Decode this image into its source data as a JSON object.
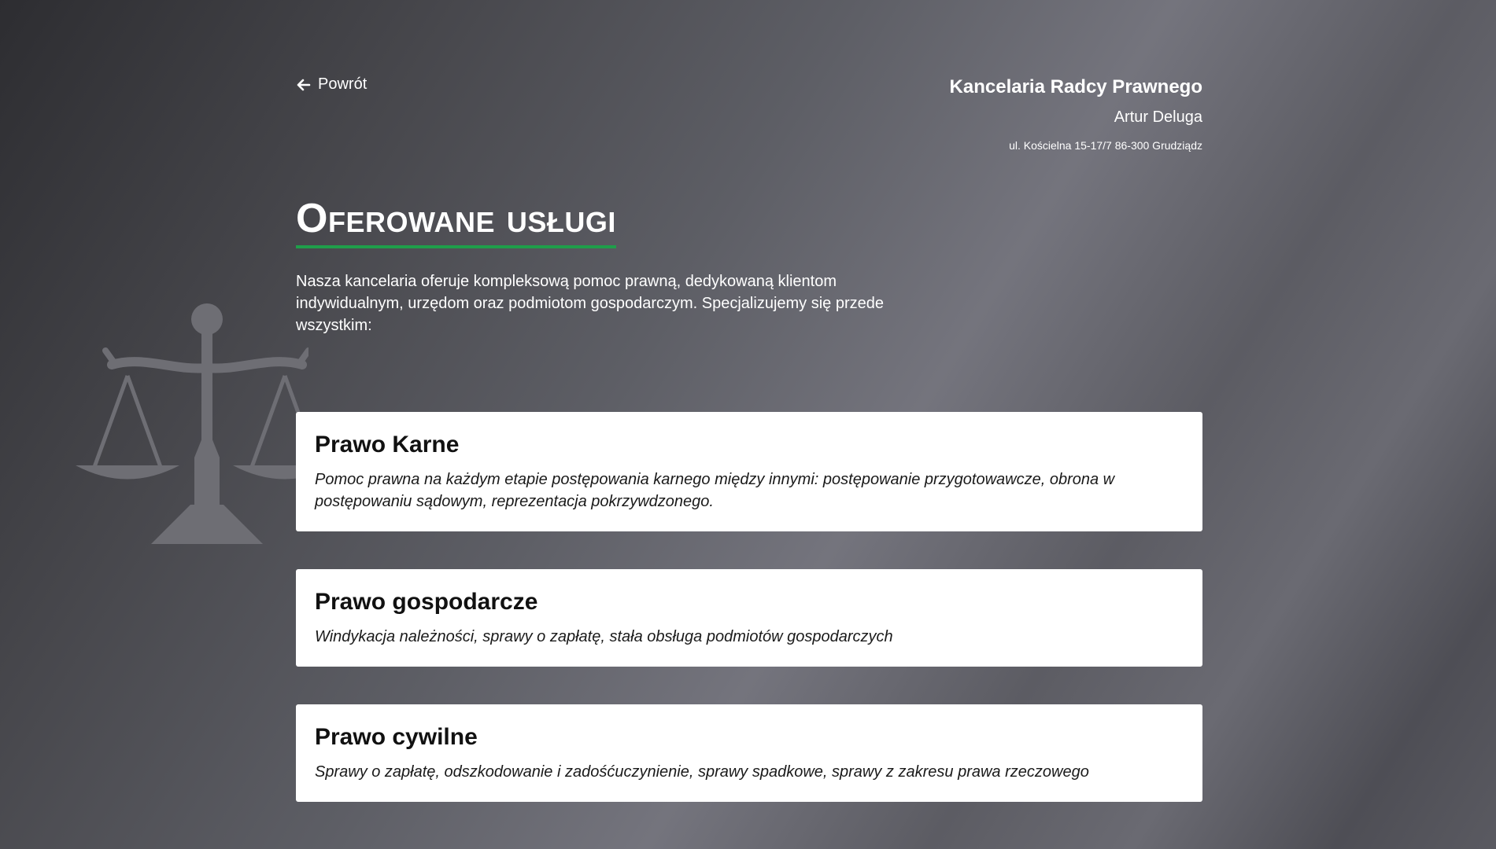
{
  "header": {
    "back_label": "Powrót",
    "firm_name": "Kancelaria Radcy Prawnego",
    "firm_person": "Artur Deluga",
    "firm_address": "ul. Kościelna 15-17/7  86-300 Grudziądz"
  },
  "main": {
    "title": "Oferowane usługi",
    "intro": "Nasza kancelaria oferuje kompleksową pomoc prawną, dedykowaną klientom indywidualnym, urzędom oraz podmiotom gospodarczym. Specjalizujemy się przede wszystkim:"
  },
  "services": [
    {
      "title": "Prawo Karne",
      "description": "Pomoc prawna na każdym etapie postępowania karnego między innymi: postępowanie przygotowawcze, obrona w postępowaniu sądowym, reprezentacja pokrzywdzonego."
    },
    {
      "title": "Prawo gospodarcze",
      "description": "Windykacja należności, sprawy o zapłatę, stała obsługa podmiotów gospodarczych"
    },
    {
      "title": "Prawo cywilne",
      "description": "Sprawy o zapłatę, odszkodowanie i zadośćuczynienie, sprawy spadkowe, sprawy z zakresu prawa rzeczowego"
    }
  ],
  "icons": {
    "back": "arrow-left-icon",
    "background": "scales-of-justice-icon"
  },
  "colors": {
    "accent_underline": "#1f9e4a",
    "card_background": "#ffffff"
  }
}
